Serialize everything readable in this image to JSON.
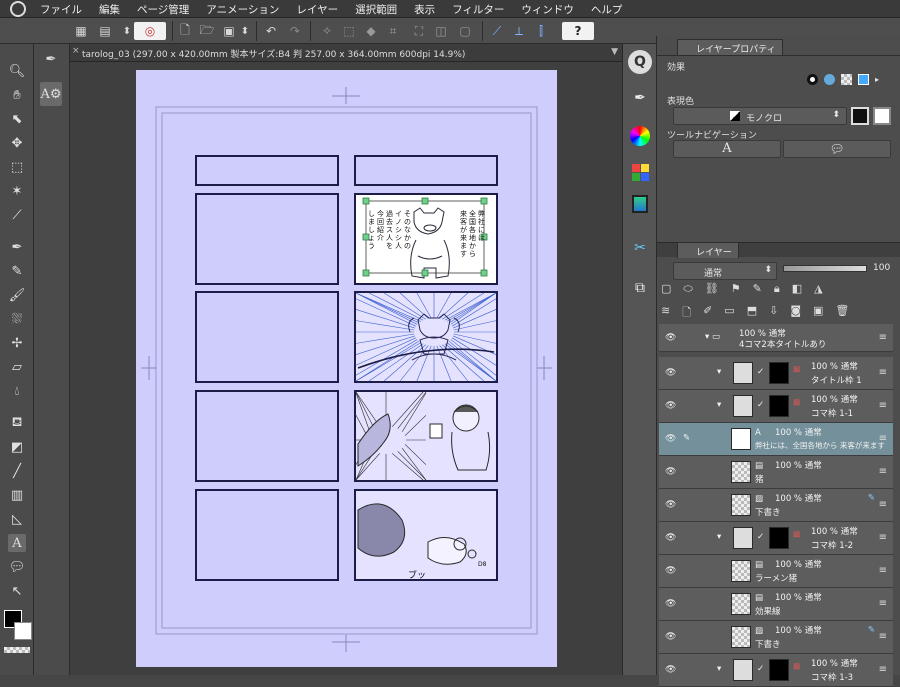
{
  "menu": [
    "ファイル",
    "編集",
    "ページ管理",
    "アニメーション",
    "レイヤー",
    "選択範囲",
    "表示",
    "フィルター",
    "ウィンドウ",
    "ヘルプ"
  ],
  "document_tab": {
    "title": "tarolog_03 (297.00 x 420.00mm 製本サイズ:B4 判 257.00 x 364.00mm 600dpi 14.9%)",
    "close": "×"
  },
  "help_button": "?",
  "layer_property": {
    "tab": "レイヤープロパティ",
    "effect_label": "効果",
    "expression_color_label": "表現色",
    "expression_color_value": "モノクロ",
    "tool_nav_label": "ツールナビゲーション",
    "text_tool_glyph": "A"
  },
  "layer_panel": {
    "tab": "レイヤー",
    "blend_mode": "通常",
    "opacity": "100",
    "layers": [
      {
        "line1": "100 % 通常",
        "line2": "4コマ2本タイトルあり",
        "kind": "folder"
      },
      {
        "line1": "100 % 通常",
        "line2": "タイトル枠 1",
        "kind": "frame"
      },
      {
        "line1": "100 % 通常",
        "line2": "コマ枠 1-1",
        "kind": "frame"
      },
      {
        "line1": "100 % 通常",
        "line2": "弊社には、全国各地から 来客が来ます",
        "kind": "text",
        "selected": true
      },
      {
        "line1": "100 % 通常",
        "line2": "猪",
        "kind": "raster"
      },
      {
        "line1": "100 % 通常",
        "line2": "下書き",
        "kind": "draft"
      },
      {
        "line1": "100 % 通常",
        "line2": "コマ枠 1-2",
        "kind": "frame"
      },
      {
        "line1": "100 % 通常",
        "line2": "ラーメン猪",
        "kind": "raster"
      },
      {
        "line1": "100 % 通常",
        "line2": "効果線",
        "kind": "raster"
      },
      {
        "line1": "100 % 通常",
        "line2": "下書き",
        "kind": "draft"
      },
      {
        "line1": "100 % 通常",
        "line2": "コマ枠 1-3",
        "kind": "frame"
      }
    ]
  },
  "canvas": {
    "panel1_text_lines": [
      "弊社には",
      "全国各地から",
      "来客が来ます"
    ],
    "panel1_text_lines_b": [
      "そのなかの",
      "イノシシ人",
      "過去ス人を",
      "今回紹介",
      "しましょう"
    ],
    "sfx_text": "ブッ",
    "sfx_small": "D8"
  },
  "colors": {
    "page": "#cfcdfb",
    "ink": "#1c1c46",
    "sketch_blue": "#3a5fcf",
    "selected_layer": "#73909b"
  }
}
